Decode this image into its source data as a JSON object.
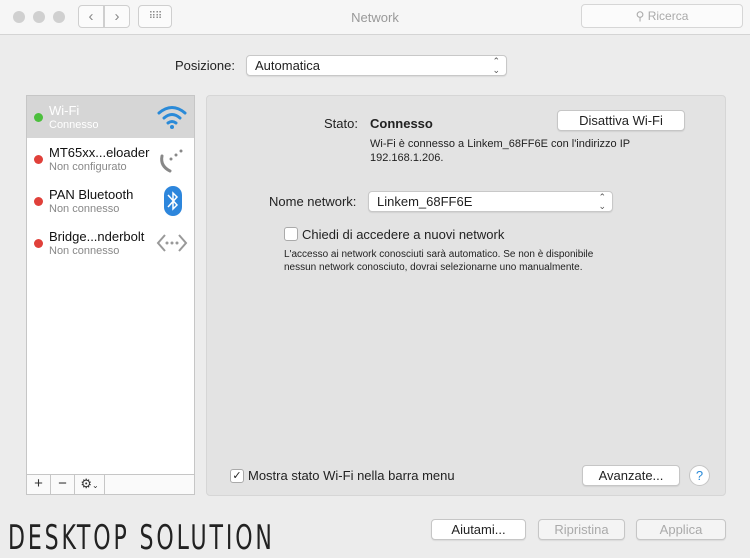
{
  "window": {
    "title": "Network",
    "search_placeholder": "Ricerca"
  },
  "location": {
    "label": "Posizione:",
    "value": "Automatica"
  },
  "sidebar": {
    "items": [
      {
        "name": "Wi-Fi",
        "status": "Connesso",
        "status_color": "#4cbf3d",
        "icon": "wifi-icon"
      },
      {
        "name": "MT65xx...eloader",
        "status": "Non configurato",
        "status_color": "#e0403a",
        "icon": "phone-icon"
      },
      {
        "name": "PAN Bluetooth",
        "status": "Non connesso",
        "status_color": "#e0403a",
        "icon": "bluetooth-icon"
      },
      {
        "name": "Bridge...nderbolt",
        "status": "Non connesso",
        "status_color": "#e0403a",
        "icon": "bridge-icon"
      }
    ],
    "add": "+",
    "remove": "−"
  },
  "detail": {
    "status_label": "Stato:",
    "status_value": "Connesso",
    "toggle_button": "Disattiva Wi-Fi",
    "status_desc_1": "Wi-Fi è connesso a Linkem_68FF6E con l'indirizzo IP",
    "status_desc_2": "192.168.1.206.",
    "network_label": "Nome network:",
    "network_value": "Linkem_68FF6E",
    "ask_label": "Chiedi di accedere a nuovi network",
    "ask_checked": false,
    "ask_desc_1": "L'accesso ai network conosciuti sarà automatico. Se non è disponibile",
    "ask_desc_2": "nessun network conosciuto, dovrai selezionarne uno manualmente.",
    "show_label": "Mostra stato Wi-Fi nella barra menu",
    "show_checked": true,
    "advanced": "Avanzate...",
    "help": "?"
  },
  "footer": {
    "assist": "Aiutami...",
    "revert": "Ripristina",
    "apply": "Applica"
  },
  "watermark": "DESKTOP SOLUTION"
}
